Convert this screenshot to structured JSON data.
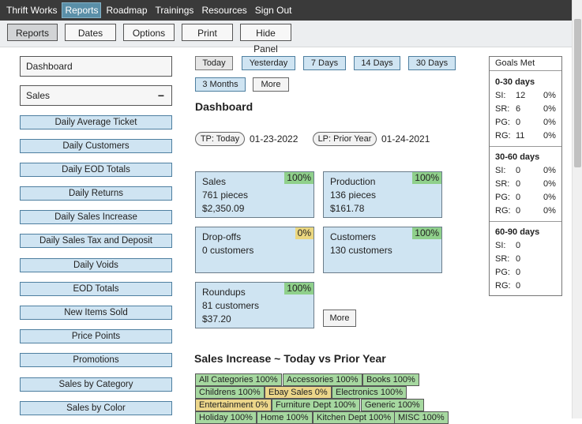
{
  "nav": {
    "items": [
      {
        "label": "Thrift Works",
        "active": false
      },
      {
        "label": "Reports",
        "active": true
      },
      {
        "label": "Roadmap",
        "active": false
      },
      {
        "label": "Trainings",
        "active": false
      },
      {
        "label": "Resources",
        "active": false
      },
      {
        "label": "Sign Out",
        "active": false
      }
    ]
  },
  "toolbar": {
    "reports": "Reports",
    "dates": "Dates",
    "options": "Options",
    "print": "Print",
    "hide_panel": "Hide Panel"
  },
  "sidebar": {
    "dashboard": "Dashboard",
    "sales": "Sales",
    "sales_toggle": "−",
    "items": [
      "Daily Average Ticket",
      "Daily Customers",
      "Daily EOD Totals",
      "Daily Returns",
      "Daily Sales Increase",
      "Daily Sales Tax and Deposit",
      "Daily Voids",
      "EOD Totals",
      "New Items Sold",
      "Price Points",
      "Promotions",
      "Sales by Category",
      "Sales by Color"
    ]
  },
  "ranges": {
    "today": "Today",
    "yesterday": "Yesterday",
    "days7": "7 Days",
    "days14": "14 Days",
    "days30": "30 Days",
    "months3": "3 Months",
    "more": "More"
  },
  "main": {
    "title": "Dashboard",
    "tp_label": "TP: Today",
    "tp_date": "01-23-2022",
    "lp_label": "LP: Prior Year",
    "lp_date": "01-24-2021",
    "more_button": "More"
  },
  "cards": [
    {
      "title": "Sales",
      "line1": "761 pieces",
      "line2": "$2,350.09",
      "pct": "100%",
      "pct_color": "#8fd08b"
    },
    {
      "title": "Production",
      "line1": "136 pieces",
      "line2": "$161.78",
      "pct": "100%",
      "pct_color": "#8fd08b"
    },
    {
      "title": "Drop-offs",
      "line1": "0 customers",
      "line2": "",
      "pct": "0%",
      "pct_color": "#ebd77f"
    },
    {
      "title": "Customers",
      "line1": "130 customers",
      "line2": "",
      "pct": "100%",
      "pct_color": "#8fd08b"
    },
    {
      "title": "Roundups",
      "line1": "81 customers",
      "line2": "$37.20",
      "pct": "100%",
      "pct_color": "#8fd08b"
    }
  ],
  "goals": {
    "title": "Goals Met",
    "sections": [
      {
        "heading": "0-30 days",
        "rows": [
          {
            "label": "SI:",
            "value": "12",
            "pct": "0%"
          },
          {
            "label": "SR:",
            "value": "6",
            "pct": "0%"
          },
          {
            "label": "PG:",
            "value": "0",
            "pct": "0%"
          },
          {
            "label": "RG:",
            "value": "11",
            "pct": "0%"
          }
        ]
      },
      {
        "heading": "30-60 days",
        "rows": [
          {
            "label": "SI:",
            "value": "0",
            "pct": "0%"
          },
          {
            "label": "SR:",
            "value": "0",
            "pct": "0%"
          },
          {
            "label": "PG:",
            "value": "0",
            "pct": "0%"
          },
          {
            "label": "RG:",
            "value": "0",
            "pct": "0%"
          }
        ]
      },
      {
        "heading": "60-90 days",
        "rows": [
          {
            "label": "SI:",
            "value": "0",
            "pct": ""
          },
          {
            "label": "SR:",
            "value": "0",
            "pct": ""
          },
          {
            "label": "PG:",
            "value": "0",
            "pct": ""
          },
          {
            "label": "RG:",
            "value": "0",
            "pct": ""
          }
        ]
      }
    ]
  },
  "sales_increase": {
    "title": "Sales Increase ~ Today vs Prior Year",
    "rows": [
      [
        {
          "text": "All Categories 100%",
          "color": "green"
        },
        {
          "text": "Accessories 100%",
          "color": "green"
        },
        {
          "text": "Books 100%",
          "color": "green"
        }
      ],
      [
        {
          "text": "Childrens 100%",
          "color": "green"
        },
        {
          "text": "Ebay Sales 0%",
          "color": "yellow"
        },
        {
          "text": "Electronics 100%",
          "color": "green"
        }
      ],
      [
        {
          "text": "Entertainment 0%",
          "color": "yellow"
        },
        {
          "text": "Furniture Dept 100%",
          "color": "green"
        },
        {
          "text": "Generic 100%",
          "color": "green"
        }
      ],
      [
        {
          "text": "Holiday 100%",
          "color": "green"
        },
        {
          "text": "Home 100%",
          "color": "green"
        },
        {
          "text": "Kitchen Dept 100%",
          "color": "green"
        },
        {
          "text": "MISC 100%",
          "color": "green"
        }
      ]
    ]
  }
}
